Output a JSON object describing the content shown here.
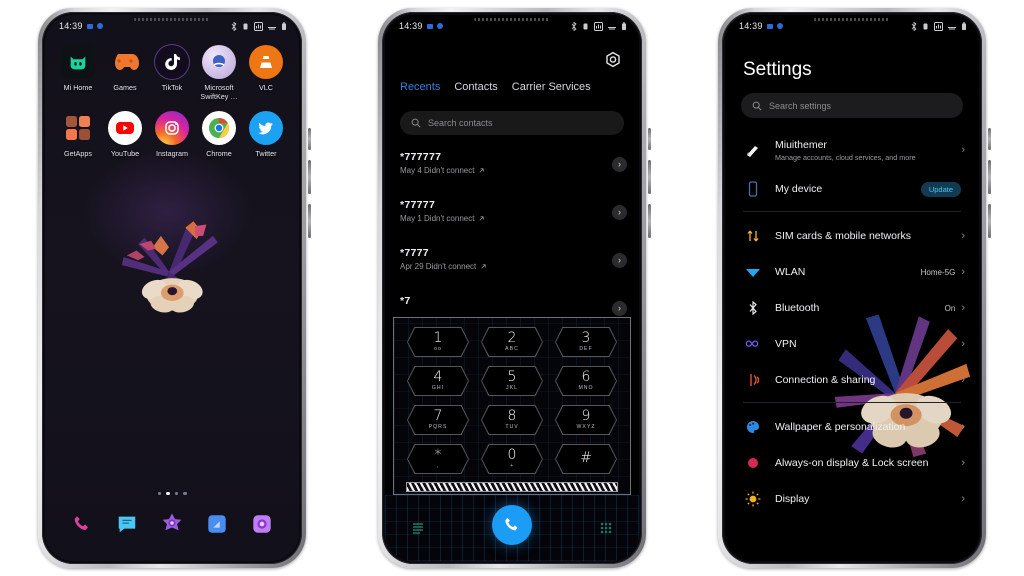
{
  "background_color": "#ffffff",
  "phones": {
    "home": {
      "status_bar": {
        "time": "14:39",
        "icons": [
          "bluetooth-icon",
          "vibrate-icon",
          "signal-icon",
          "wifi-icon",
          "battery-icon"
        ]
      },
      "apps_row1": [
        {
          "label": "Mi Home",
          "icon": "mi-home-icon",
          "color": "#17d49b"
        },
        {
          "label": "Games",
          "icon": "games-icon",
          "color": "#f0772e"
        },
        {
          "label": "TikTok",
          "icon": "tiktok-icon",
          "color": "#120a1c"
        },
        {
          "label": "Microsoft SwiftKey …",
          "icon": "swiftkey-icon",
          "color": "#d9ccea"
        },
        {
          "label": "VLC",
          "icon": "vlc-icon",
          "color": "#ef7615"
        }
      ],
      "apps_row2": [
        {
          "label": "GetApps",
          "icon": "getapps-icon",
          "color": "#e8643c"
        },
        {
          "label": "YouTube",
          "icon": "youtube-icon",
          "color": "#ffffff"
        },
        {
          "label": "Instagram",
          "icon": "instagram-icon",
          "color": "#d62976"
        },
        {
          "label": "Chrome",
          "icon": "chrome-icon",
          "color": "#4285f4"
        },
        {
          "label": "Twitter",
          "icon": "twitter-icon",
          "color": "#1da1f2"
        }
      ],
      "page_dots": {
        "count": 4,
        "active_index": 1
      },
      "dock": [
        {
          "icon": "phone-icon",
          "color": "#d9449b"
        },
        {
          "icon": "messages-icon",
          "color": "#4cc6f5"
        },
        {
          "icon": "camera-star-icon",
          "color": "#a05ce0"
        },
        {
          "icon": "files-icon",
          "color": "#4a8df0"
        },
        {
          "icon": "gallery-icon",
          "color": "#c07ef5"
        }
      ],
      "wallpaper": "dark-tropical-flower"
    },
    "dialer": {
      "status_bar": {
        "time": "14:39"
      },
      "settings_icon": "hex-gear-icon",
      "tabs": [
        {
          "label": "Recents",
          "active": true
        },
        {
          "label": "Contacts",
          "active": false
        },
        {
          "label": "Carrier Services",
          "active": false
        }
      ],
      "search": {
        "placeholder": "Search contacts",
        "icon": "search-icon"
      },
      "call_log": [
        {
          "number": "*777777",
          "detail": "May 4 Didn't connect",
          "direction": "outgoing-arrow-icon"
        },
        {
          "number": "*77777",
          "detail": "May 1 Didn't connect",
          "direction": "outgoing-arrow-icon"
        },
        {
          "number": "*7777",
          "detail": "Apr 29 Didn't connect",
          "direction": "outgoing-arrow-icon"
        },
        {
          "number": "*7",
          "detail": "",
          "direction": "outgoing-arrow-icon"
        }
      ],
      "keypad": [
        {
          "digit": "1",
          "letters": "oo"
        },
        {
          "digit": "2",
          "letters": "ABC"
        },
        {
          "digit": "3",
          "letters": "DEF"
        },
        {
          "digit": "4",
          "letters": "GHI"
        },
        {
          "digit": "5",
          "letters": "JKL"
        },
        {
          "digit": "6",
          "letters": "MNO"
        },
        {
          "digit": "7",
          "letters": "PQRS"
        },
        {
          "digit": "8",
          "letters": "TUV"
        },
        {
          "digit": "9",
          "letters": "WXYZ"
        },
        {
          "digit": "*",
          "letters": ","
        },
        {
          "digit": "0",
          "letters": "+"
        },
        {
          "digit": "#",
          "letters": ""
        }
      ],
      "bottom_bar": {
        "left_icon": "call-log-list-icon",
        "call_icon": "call-icon",
        "right_icon": "dialpad-grid-icon",
        "call_button_color": "#1b9cf5"
      }
    },
    "settings": {
      "status_bar": {
        "time": "14:39"
      },
      "title": "Settings",
      "search": {
        "placeholder": "Search settings",
        "icon": "search-icon"
      },
      "group_account": [
        {
          "label": "Miuithemer",
          "description": "Manage accounts, cloud services, and more",
          "icon": "account-icon",
          "value": "",
          "badge": "",
          "chevron": "›"
        },
        {
          "label": "My device",
          "description": "",
          "icon": "device-icon",
          "value": "",
          "badge": "Update",
          "chevron": ""
        }
      ],
      "group_network": [
        {
          "label": "SIM cards & mobile networks",
          "icon": "sim-icon",
          "value": "",
          "chevron": "›"
        },
        {
          "label": "WLAN",
          "icon": "wlan-icon",
          "value": "Home-5G",
          "chevron": "›"
        },
        {
          "label": "Bluetooth",
          "icon": "bluetooth-icon",
          "value": "On",
          "chevron": "›"
        },
        {
          "label": "VPN",
          "icon": "vpn-icon",
          "value": "",
          "chevron": "›"
        },
        {
          "label": "Connection & sharing",
          "icon": "connection-sharing-icon",
          "value": "",
          "chevron": "›"
        }
      ],
      "group_personal": [
        {
          "label": "Wallpaper & personalization",
          "icon": "wallpaper-icon",
          "value": "",
          "chevron": "›"
        },
        {
          "label": "Always-on display & Lock screen",
          "icon": "aod-icon",
          "value": "",
          "chevron": "›"
        },
        {
          "label": "Display",
          "icon": "display-icon",
          "value": "",
          "chevron": "›"
        }
      ]
    }
  }
}
